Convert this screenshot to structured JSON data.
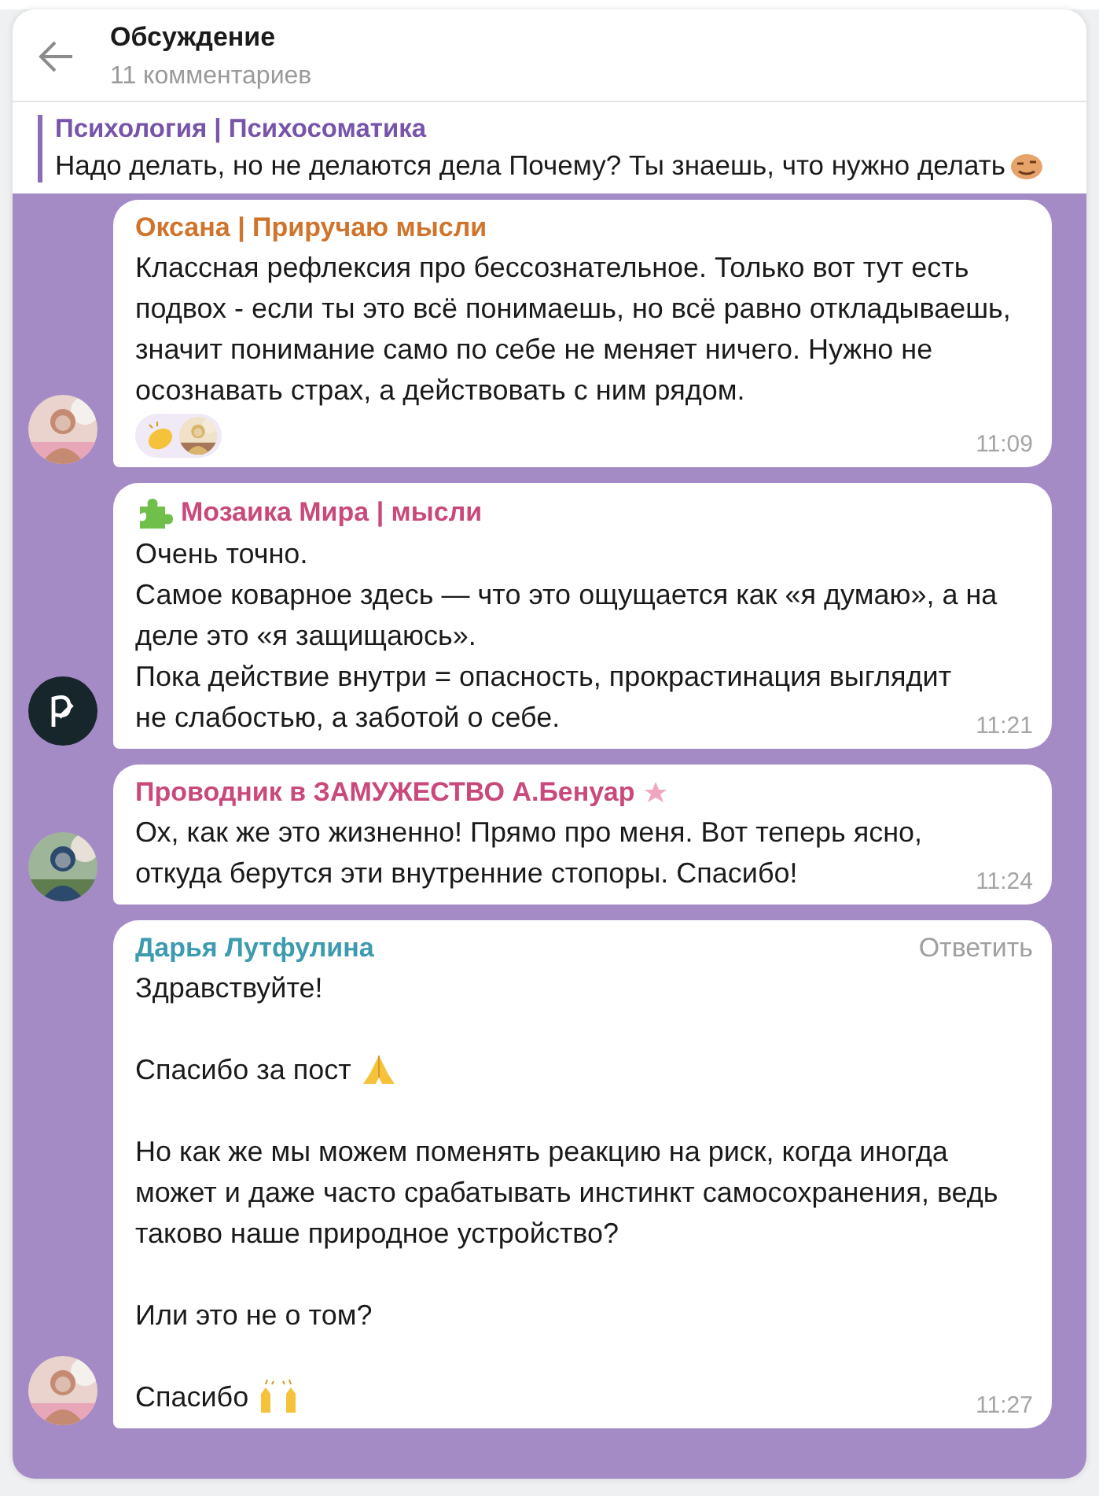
{
  "header": {
    "title": "Обсуждение",
    "subtitle": "11 комментариев"
  },
  "pinned": {
    "title": "Психология | Психосоматика",
    "text": "Надо делать, но не делаются дела  Почему?  Ты знаешь, что нужно делать"
  },
  "messages": [
    {
      "author": "Оксана | Приручаю мысли",
      "color": "#d0742c",
      "reaction": true,
      "time": "11:09",
      "paragraphs": [
        {
          "kind": "plain",
          "text": "Классная рефлексия про бессознательное. Только вот тут есть подвох - если ты это всё понимаешь, но всё равно откладываешь, значит понимание само по себе не меняет ничего. Нужно не осознавать страх, а действовать с ним рядом."
        }
      ]
    },
    {
      "author": "Мозаика Мира | мысли",
      "color": "#c9497c",
      "avatar": {
        "kind": "logo"
      },
      "badge": {
        "kind": "puzzle"
      },
      "spaced": false,
      "reaction": false,
      "time": "11:21",
      "paragraphs": [
        {
          "kind": "plain",
          "text": "Очень точно."
        },
        {
          "kind": "plain",
          "text": "Самое коварное здесь — что это ощущается как «я думаю», а на деле это «я защищаюсь»."
        },
        {
          "kind": "plain",
          "text": "Пока действие внутри = опасность, прокрастинация выглядит не слабостью, а заботой о себе."
        }
      ]
    },
    {
      "author": "Проводник в ЗАМУЖЕСТВО А.Бенуар",
      "color": "#c9497c",
      "badge": {
        "kind": "star"
      },
      "reaction": false,
      "time": "11:24",
      "paragraphs": [
        {
          "kind": "plain",
          "text": "Ох, как же это жизненно! Прямо про меня. Вот теперь ясно, откуда берутся эти внутренние стопоры. Спасибо!"
        }
      ]
    },
    {
      "author": "Дарья Лутфулина",
      "color": "#3d9bb0",
      "spaced": true,
      "reaction": false,
      "reply": "Ответить",
      "time": "11:27",
      "paragraphs": [
        {
          "kind": "plain",
          "text": "Здравствуйте!"
        },
        {
          "kind": "pray",
          "text": "Спасибо за пост"
        },
        {
          "kind": "plain",
          "text": "Но как же мы можем поменять реакцию на риск, когда иногда может и даже часто срабатывать инстинкт самосохранения, ведь таково наше природное устройство?"
        },
        {
          "kind": "plain",
          "text": "Или это не о том?"
        },
        {
          "kind": "hands",
          "text": "Спасибо"
        }
      ]
    }
  ]
}
